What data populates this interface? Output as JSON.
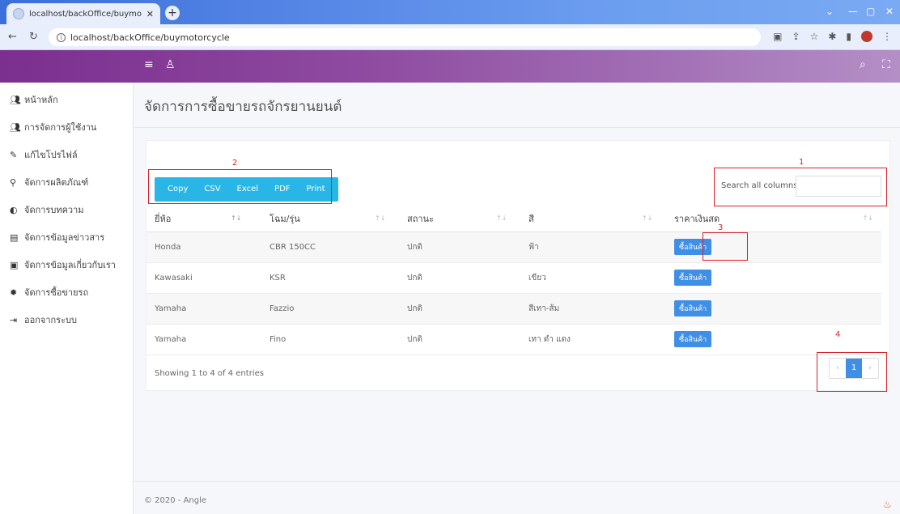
{
  "browser": {
    "tab_title": "localhost/backOffice/buymotorc",
    "url": "localhost/backOffice/buymotorcycle"
  },
  "sidebar": {
    "items": [
      {
        "label": "หน้าหลัก",
        "icon": "users-icon"
      },
      {
        "label": "การจัดการผู้ใช้งาน",
        "icon": "users-icon"
      },
      {
        "label": "แก้ไขโปรไฟล์",
        "icon": "user-edit-icon"
      },
      {
        "label": "จัดการผลิตภัณฑ์",
        "icon": "sitemap-icon"
      },
      {
        "label": "จัดการบทความ",
        "icon": "half-circle-icon"
      },
      {
        "label": "จัดการข้อมูลข่าวสาร",
        "icon": "news-icon"
      },
      {
        "label": "จัดการข้อมูลเกี่ยวกับเรา",
        "icon": "id-card-icon"
      },
      {
        "label": "จัดการซื้อขายรถ",
        "icon": "gear-icon"
      },
      {
        "label": "ออกจากระบบ",
        "icon": "logout-icon"
      }
    ]
  },
  "page": {
    "title": "จัดการการซื้อขายรถจักรยานยนต์"
  },
  "toolbar": {
    "copy": "Copy",
    "csv": "CSV",
    "excel": "Excel",
    "pdf": "PDF",
    "print": "Print"
  },
  "search": {
    "label": "Search all columns:",
    "value": ""
  },
  "table": {
    "headers": [
      "ยี่ห้อ",
      "โฉม/รุ่น",
      "สถานะ",
      "สี",
      "ราคาเงินสด"
    ],
    "rows": [
      {
        "brand": "Honda",
        "model": "CBR 150CC",
        "status": "ปกติ",
        "color": "ฟ้า",
        "action": "ซื้อสินค้า"
      },
      {
        "brand": "Kawasaki",
        "model": "KSR",
        "status": "ปกติ",
        "color": "เขียว",
        "action": "ซื้อสินค้า"
      },
      {
        "brand": "Yamaha",
        "model": "Fazzio",
        "status": "ปกติ",
        "color": "สีเทา-ส้ม",
        "action": "ซื้อสินค้า"
      },
      {
        "brand": "Yamaha",
        "model": "Fino",
        "status": "ปกติ",
        "color": "เทา ดำ แดง",
        "action": "ซื้อสินค้า"
      }
    ],
    "info": "Showing 1 to 4 of 4 entries",
    "current_page": "1"
  },
  "annotations": [
    "1",
    "2",
    "3",
    "4"
  ],
  "footer": "© 2020 - Angle",
  "colors": {
    "header_start": "#7b2f8f",
    "header_end": "#b48fc6",
    "export_bar": "#29b6e6",
    "buy_button": "#3f8fe6",
    "annotation": "#d9202a"
  }
}
